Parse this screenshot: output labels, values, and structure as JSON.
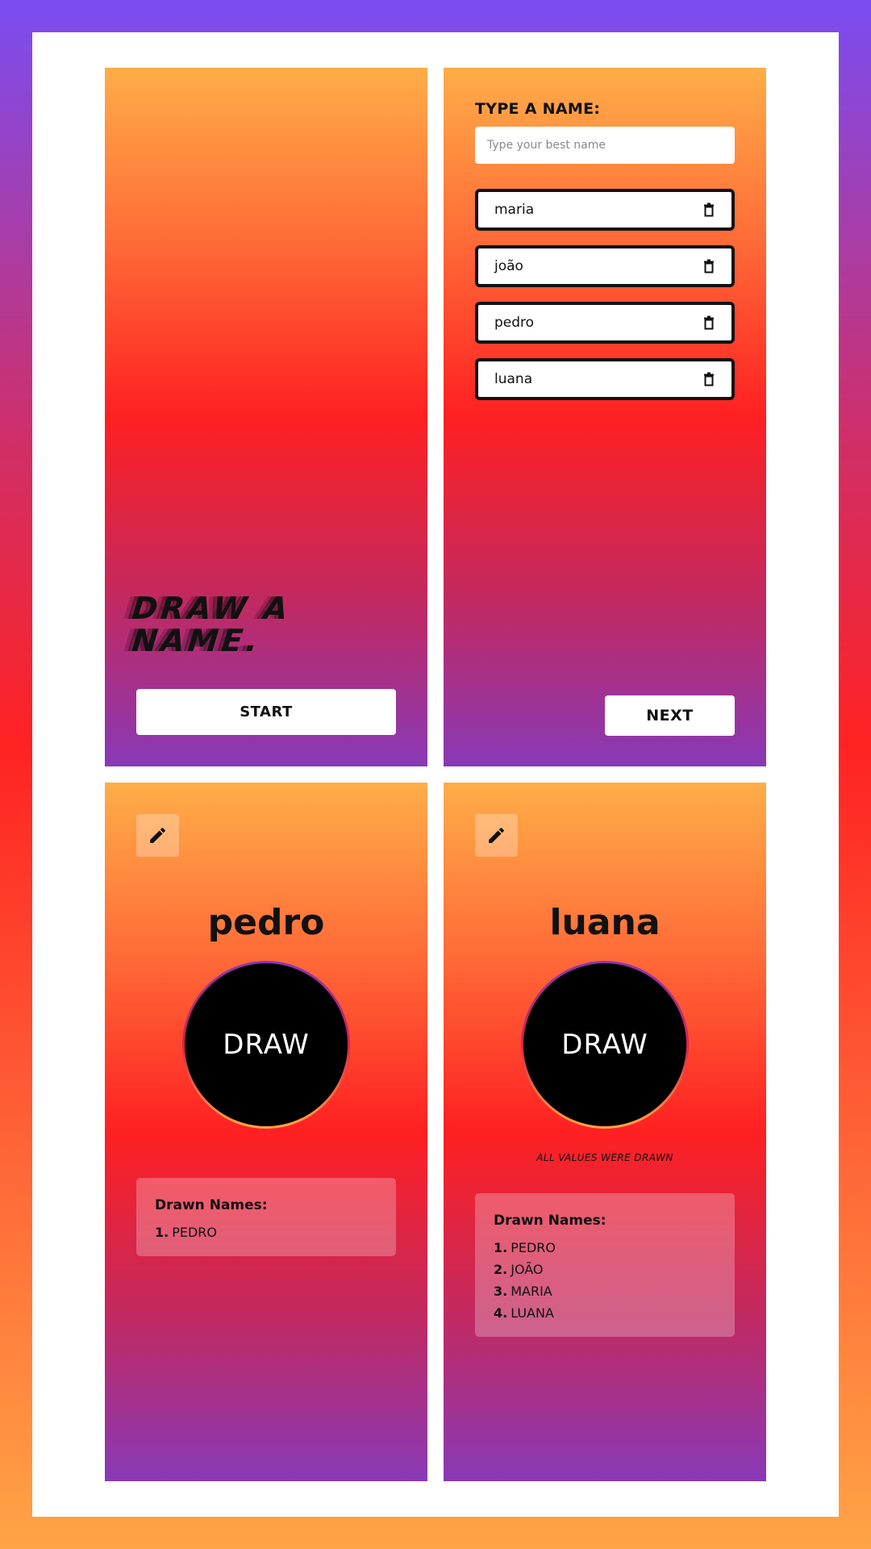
{
  "start_screen": {
    "logo_lines": [
      "DRAW A",
      "NAME."
    ],
    "start_label": "START"
  },
  "names_screen": {
    "prompt": "TYPE A NAME:",
    "input": {
      "value": "",
      "placeholder": "Type your best name"
    },
    "names": [
      "maria",
      "joão",
      "pedro",
      "luana"
    ],
    "delete_icon": "trash-icon",
    "next_label": "NEXT"
  },
  "draw_screen_1": {
    "edit_icon": "pencil-icon",
    "current_name": "pedro",
    "draw_label": "DRAW",
    "drawn_title": "Drawn Names:",
    "drawn": [
      {
        "num": "1.",
        "name": "PEDRO"
      }
    ]
  },
  "draw_screen_2": {
    "edit_icon": "pencil-icon",
    "current_name": "luana",
    "draw_label": "DRAW",
    "status": "ALL VALUES WERE DRAWN",
    "drawn_title": "Drawn Names:",
    "drawn": [
      {
        "num": "1.",
        "name": "PEDRO"
      },
      {
        "num": "2.",
        "name": "JOÃO"
      },
      {
        "num": "3.",
        "name": "MARIA"
      },
      {
        "num": "4.",
        "name": "LUANA"
      }
    ]
  },
  "colors": {
    "frame_gradient": [
      "#7a4df2",
      "#ff2222",
      "#ffa446"
    ],
    "panel_gradient": [
      "#ffad48",
      "#ff2022",
      "#8839b7"
    ],
    "button_background": "#ffffff",
    "draw_button": "#000000"
  }
}
